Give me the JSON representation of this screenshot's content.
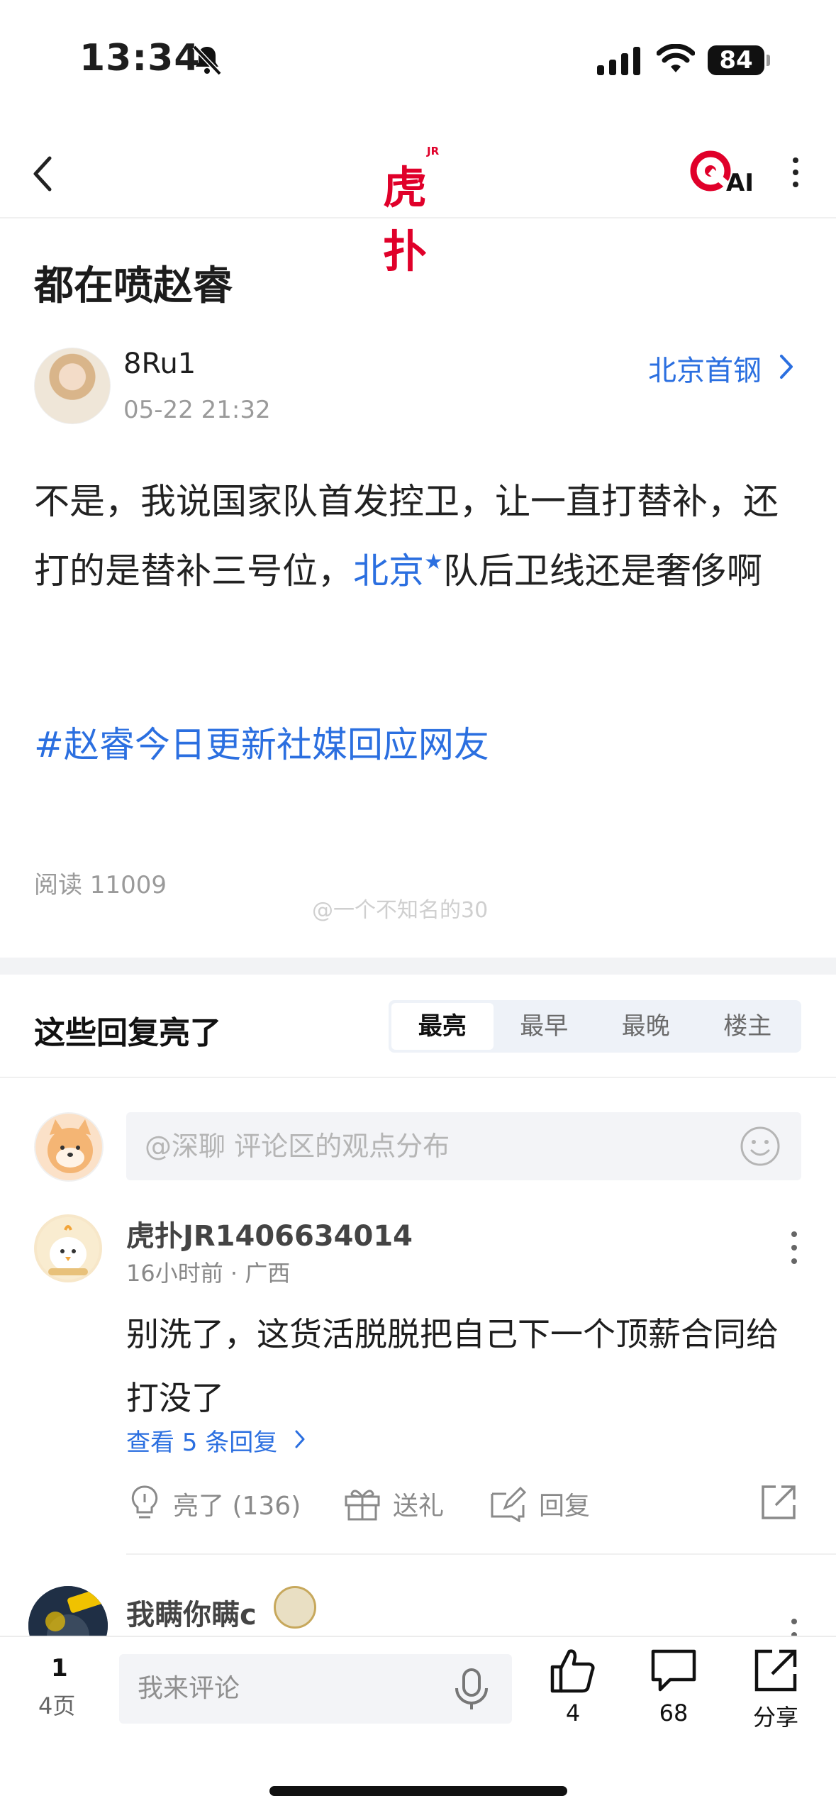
{
  "status_bar": {
    "time": "13:34",
    "battery": "84"
  },
  "nav": {
    "logo_main": "虎扑",
    "logo_sup": "JR",
    "ai_label": "AI"
  },
  "post": {
    "title": "都在喷赵睿",
    "author": "8Ru1",
    "time": "05-22 21:32",
    "board": "北京首钢",
    "body_part1": "不是，我说国家队首发控卫，让一直打替补，还打的是替补三号位，",
    "body_link": "北京",
    "body_part2": "队后卫线还是奢侈啊",
    "topic": "#赵睿今日更新社媒回应网友",
    "read_count": "阅读 11009",
    "watermark": "@一个不知名的30"
  },
  "replies": {
    "title": "这些回复亮了",
    "sort_tabs": [
      "最亮",
      "最早",
      "最晚",
      "楼主"
    ],
    "active_tab": "最亮",
    "deep_talk_placeholder": "@深聊 评论区的观点分布"
  },
  "comments": [
    {
      "name": "虎扑JR1406634014",
      "meta": "16小时前 · 广西",
      "text": "别洗了，这货活脱脱把自己下一个顶薪合同给打没了",
      "view_replies": "查看 5 条回复",
      "actions": {
        "light": "亮了 (136)",
        "gift": "送礼",
        "reply": "回复"
      }
    },
    {
      "name": "我瞒你瞒c"
    }
  ],
  "bottom_bar": {
    "page": "1",
    "pages": "4页",
    "comment_placeholder": "我来评论",
    "likes": "4",
    "comments": "68",
    "share": "分享"
  },
  "colors": {
    "brand_red": "#e0002a",
    "link_blue": "#2b6fe0",
    "muted_gray": "#9a9a9a"
  },
  "icons": [
    "bell-slash-icon",
    "signal-icon",
    "wifi-icon",
    "back-icon",
    "hupu-logo",
    "ai-icon",
    "more-icon",
    "chevron-right-icon",
    "smile-icon",
    "lightbulb-icon",
    "gift-icon",
    "reply-edit-icon",
    "share-out-icon",
    "mic-icon",
    "thumbs-up-icon",
    "comment-bubble-icon"
  ]
}
